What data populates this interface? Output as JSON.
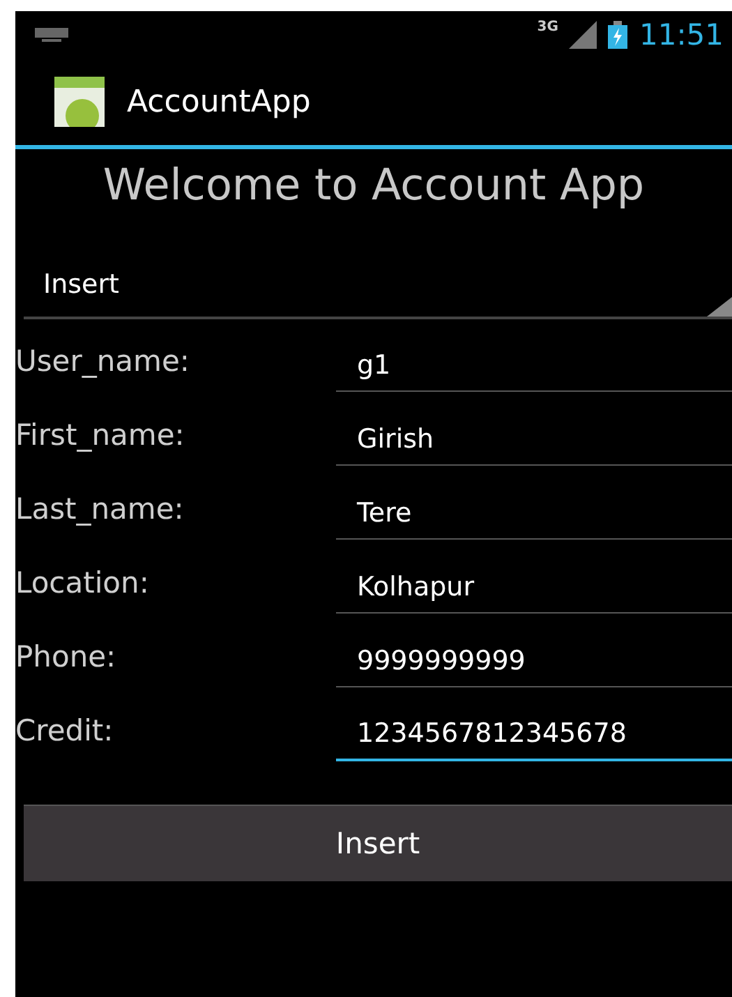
{
  "status_bar": {
    "network": "3G",
    "time": "11:51"
  },
  "action_bar": {
    "title": "AccountApp"
  },
  "heading": "Welcome to Account App",
  "spinner": {
    "value": "Insert"
  },
  "fields": [
    {
      "label": "User_name:",
      "value": "g1",
      "focused": false
    },
    {
      "label": "First_name:",
      "value": "Girish",
      "focused": false
    },
    {
      "label": "Last_name:",
      "value": "Tere",
      "focused": false
    },
    {
      "label": "Location:",
      "value": "Kolhapur",
      "focused": false
    },
    {
      "label": "Phone:",
      "value": "9999999999",
      "focused": false
    },
    {
      "label": "Credit:",
      "value": "1234567812345678",
      "focused": true
    }
  ],
  "button": {
    "label": "Insert"
  }
}
